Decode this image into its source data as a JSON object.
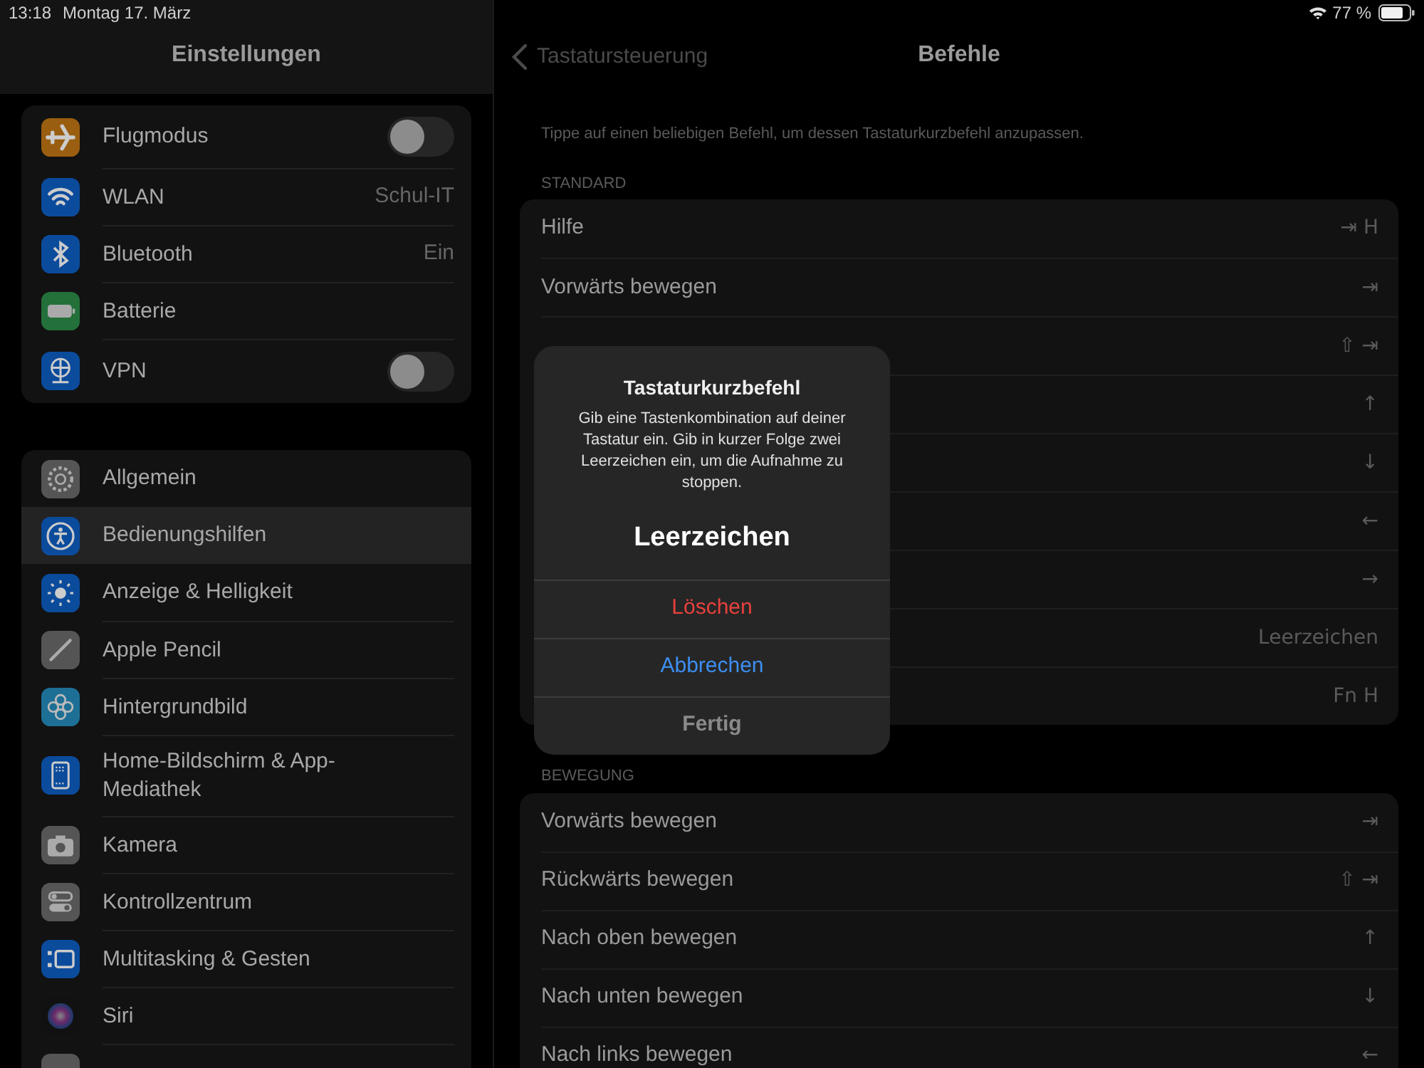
{
  "status_bar": {
    "time": "13:18",
    "date": "Montag 17. März",
    "battery": "77 %"
  },
  "sidebar": {
    "title": "Einstellungen",
    "groups": [
      [
        {
          "label": "Flugmodus",
          "kind": "toggle",
          "on": false,
          "selected": false
        },
        {
          "label": "WLAN",
          "kind": "value",
          "value": "Schul-IT",
          "selected": false
        },
        {
          "label": "Bluetooth",
          "kind": "value",
          "value": "Ein",
          "selected": false
        },
        {
          "label": "Batterie",
          "kind": "plain",
          "selected": false
        },
        {
          "label": "VPN",
          "kind": "toggle",
          "on": false,
          "selected": false
        }
      ],
      [
        {
          "label": "Allgemein",
          "kind": "plain",
          "selected": false
        },
        {
          "label": "Bedienungshilfen",
          "kind": "plain",
          "selected": true
        },
        {
          "label": "Anzeige & Helligkeit",
          "kind": "plain",
          "selected": false
        },
        {
          "label": "Apple Pencil",
          "kind": "plain",
          "selected": false
        },
        {
          "label": "Hintergrundbild",
          "kind": "plain",
          "selected": false
        },
        {
          "label": "Home-Bildschirm & App-Mediathek",
          "kind": "plain",
          "selected": false
        },
        {
          "label": "Kamera",
          "kind": "plain",
          "selected": false
        },
        {
          "label": "Kontrollzentrum",
          "kind": "plain",
          "selected": false
        },
        {
          "label": "Multitasking & Gesten",
          "kind": "plain",
          "selected": false
        },
        {
          "label": "Siri",
          "kind": "plain",
          "selected": false
        },
        {
          "kind": "plain",
          "selected": false
        }
      ]
    ]
  },
  "detail": {
    "back": "Tastatursteuerung",
    "title": "Befehle",
    "hint": "Tippe auf einen beliebigen Befehl, um dessen Tastaturkurzbefehl anzupassen.",
    "sections": [
      {
        "header": "STANDARD",
        "rows": [
          {
            "label": "Hilfe",
            "shortcut": "⇥ H"
          },
          {
            "label": "Vorwärts bewegen",
            "shortcut": "⇥"
          },
          {
            "shortcut": "⇧ ⇥"
          },
          {
            "shortcut": "↑"
          },
          {
            "shortcut": "↓"
          },
          {
            "shortcut": "←"
          },
          {
            "shortcut": "→"
          },
          {
            "shortcut": "Leerzeichen"
          },
          {
            "shortcut": "Fn H"
          }
        ]
      },
      {
        "header": "BEWEGUNG",
        "rows": [
          {
            "label": "Vorwärts bewegen",
            "shortcut": "⇥"
          },
          {
            "label": "Rückwärts bewegen",
            "shortcut": "⇧ ⇥"
          },
          {
            "label": "Nach oben bewegen",
            "shortcut": "↑"
          },
          {
            "label": "Nach unten bewegen",
            "shortcut": "↓"
          },
          {
            "label": "Nach links bewegen",
            "shortcut": "←"
          }
        ]
      }
    ]
  },
  "dialog": {
    "title": "Tastaturkurzbefehl",
    "message": "Gib eine Tastenkombination auf deiner Tastatur ein. Gib in kurzer Folge zwei Leerzeichen ein, um die Aufnahme zu stoppen.",
    "value": "Leerzeichen",
    "actions": [
      {
        "label": "Löschen",
        "kind": "destructive"
      },
      {
        "label": "Abbrechen",
        "kind": "cancel"
      },
      {
        "label": "Fertig",
        "kind": "default"
      }
    ]
  }
}
